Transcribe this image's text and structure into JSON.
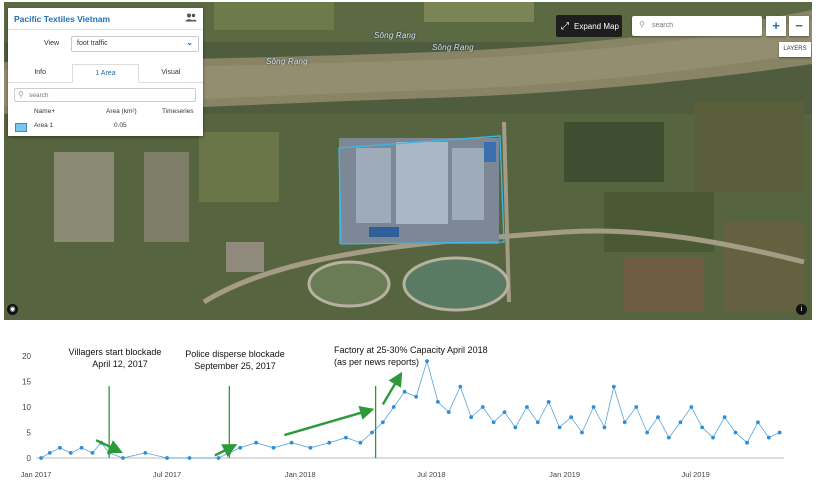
{
  "panel": {
    "title": "Pacific Textiles Vietnam",
    "view_label": "View",
    "view_value": "foot traffic",
    "tabs": [
      "Info",
      "1 Area",
      "Visual"
    ],
    "active_tab": 1,
    "search_placeholder": "search",
    "columns": [
      "Name+",
      "Area (km²)",
      "Timeseries"
    ],
    "rows": [
      {
        "name": "Area 1",
        "area": "0.05",
        "timeseries": ""
      }
    ]
  },
  "map": {
    "expand_label": "Expand Map",
    "search_placeholder": "search",
    "zoom_in": "+",
    "zoom_out": "−",
    "layers_label": "LAYERS",
    "river_labels": [
      "Sông Rạng",
      "Sông Rạng",
      "Sông Rạng"
    ]
  },
  "annotations": {
    "a1_line1": "Villagers start blockade",
    "a1_line2": "April 12, 2017",
    "a2_line1": "Police disperse blockade",
    "a2_line2": "September 25, 2017",
    "a3_line1": "Factory at 25-30% Capacity April 2018",
    "a3_line2": "(as per news reports)"
  },
  "colors": {
    "series": "#2e8fd6",
    "marker_line": "#2c9a3a",
    "arrow": "#2c9a3a",
    "panel_title": "#1f6fb5",
    "area_outline": "#3fb8e6"
  },
  "chart_data": {
    "type": "line",
    "title": "",
    "xlabel": "",
    "ylabel": "",
    "ylim": [
      0,
      20
    ],
    "y_ticks": [
      0,
      5,
      10,
      15,
      20
    ],
    "x_ticks": [
      {
        "date": "2017-01-01",
        "label": "Jan 2017"
      },
      {
        "date": "2017-07-01",
        "label": "Jul 2017"
      },
      {
        "date": "2018-01-01",
        "label": "Jan 2018"
      },
      {
        "date": "2018-07-01",
        "label": "Jul 2018"
      },
      {
        "date": "2019-01-01",
        "label": "Jan 2019"
      },
      {
        "date": "2019-07-01",
        "label": "Jul 2019"
      }
    ],
    "x_range": [
      "2017-01-01",
      "2019-10-31"
    ],
    "grid": false,
    "vertical_markers": [
      "2017-04-12",
      "2017-09-25",
      "2018-04-15"
    ],
    "series": [
      {
        "values": [
          {
            "x": "2017-01-08",
            "y": 0
          },
          {
            "x": "2017-01-20",
            "y": 1
          },
          {
            "x": "2017-02-03",
            "y": 2
          },
          {
            "x": "2017-02-18",
            "y": 1
          },
          {
            "x": "2017-03-05",
            "y": 2
          },
          {
            "x": "2017-03-20",
            "y": 1
          },
          {
            "x": "2017-04-01",
            "y": 3
          },
          {
            "x": "2017-04-12",
            "y": 1
          },
          {
            "x": "2017-05-01",
            "y": 0
          },
          {
            "x": "2017-06-01",
            "y": 1
          },
          {
            "x": "2017-07-01",
            "y": 0
          },
          {
            "x": "2017-08-01",
            "y": 0
          },
          {
            "x": "2017-09-10",
            "y": 0
          },
          {
            "x": "2017-09-25",
            "y": 1
          },
          {
            "x": "2017-10-10",
            "y": 2
          },
          {
            "x": "2017-11-01",
            "y": 3
          },
          {
            "x": "2017-11-25",
            "y": 2
          },
          {
            "x": "2017-12-20",
            "y": 3
          },
          {
            "x": "2018-01-15",
            "y": 2
          },
          {
            "x": "2018-02-10",
            "y": 3
          },
          {
            "x": "2018-03-05",
            "y": 4
          },
          {
            "x": "2018-03-25",
            "y": 3
          },
          {
            "x": "2018-04-10",
            "y": 5
          },
          {
            "x": "2018-04-25",
            "y": 7
          },
          {
            "x": "2018-05-10",
            "y": 10
          },
          {
            "x": "2018-05-25",
            "y": 13
          },
          {
            "x": "2018-06-10",
            "y": 12
          },
          {
            "x": "2018-06-25",
            "y": 19
          },
          {
            "x": "2018-07-10",
            "y": 11
          },
          {
            "x": "2018-07-25",
            "y": 9
          },
          {
            "x": "2018-08-10",
            "y": 14
          },
          {
            "x": "2018-08-25",
            "y": 8
          },
          {
            "x": "2018-09-10",
            "y": 10
          },
          {
            "x": "2018-09-25",
            "y": 7
          },
          {
            "x": "2018-10-10",
            "y": 9
          },
          {
            "x": "2018-10-25",
            "y": 6
          },
          {
            "x": "2018-11-10",
            "y": 10
          },
          {
            "x": "2018-11-25",
            "y": 7
          },
          {
            "x": "2018-12-10",
            "y": 11
          },
          {
            "x": "2018-12-25",
            "y": 6
          },
          {
            "x": "2019-01-10",
            "y": 8
          },
          {
            "x": "2019-01-25",
            "y": 5
          },
          {
            "x": "2019-02-10",
            "y": 10
          },
          {
            "x": "2019-02-25",
            "y": 6
          },
          {
            "x": "2019-03-10",
            "y": 14
          },
          {
            "x": "2019-03-25",
            "y": 7
          },
          {
            "x": "2019-04-10",
            "y": 10
          },
          {
            "x": "2019-04-25",
            "y": 5
          },
          {
            "x": "2019-05-10",
            "y": 8
          },
          {
            "x": "2019-05-25",
            "y": 4
          },
          {
            "x": "2019-06-10",
            "y": 7
          },
          {
            "x": "2019-06-25",
            "y": 10
          },
          {
            "x": "2019-07-10",
            "y": 6
          },
          {
            "x": "2019-07-25",
            "y": 4
          },
          {
            "x": "2019-08-10",
            "y": 8
          },
          {
            "x": "2019-08-25",
            "y": 5
          },
          {
            "x": "2019-09-10",
            "y": 3
          },
          {
            "x": "2019-09-25",
            "y": 7
          },
          {
            "x": "2019-10-10",
            "y": 4
          },
          {
            "x": "2019-10-25",
            "y": 5
          }
        ]
      }
    ]
  }
}
